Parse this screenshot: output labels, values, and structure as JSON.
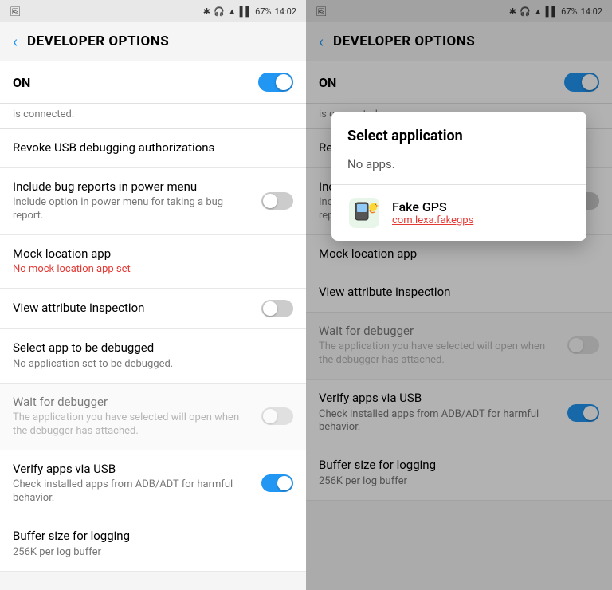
{
  "left_panel": {
    "status": {
      "left_icon": "📷",
      "bluetooth": "🔵",
      "wifi": "📶",
      "signal": "📶",
      "battery": "67%",
      "time": "14:02"
    },
    "header": {
      "back_label": "‹",
      "title": "DEVELOPER OPTIONS"
    },
    "on_label": "ON",
    "connected_text": "is connected.",
    "toggle_on": true,
    "items": [
      {
        "id": "revoke-usb",
        "title": "Revoke USB debugging authorizations",
        "subtitle": null,
        "toggle": null,
        "enabled": true
      },
      {
        "id": "bug-report",
        "title": "Include bug reports in power menu",
        "subtitle": "Include option in power menu for taking a bug report.",
        "toggle": "off",
        "enabled": true
      },
      {
        "id": "mock-location",
        "title": "Mock location app",
        "subtitle": "No mock location app set",
        "subtitle_red": true,
        "toggle": null,
        "enabled": true
      },
      {
        "id": "view-attr",
        "title": "View attribute inspection",
        "subtitle": null,
        "toggle": "off",
        "enabled": true
      },
      {
        "id": "select-debug",
        "title": "Select app to be debugged",
        "subtitle": "No application set to be debugged.",
        "toggle": null,
        "enabled": true
      },
      {
        "id": "wait-debugger",
        "title": "Wait for debugger",
        "subtitle": "The application you have selected will open when the debugger has attached.",
        "toggle": "off",
        "enabled": false
      },
      {
        "id": "verify-usb",
        "title": "Verify apps via USB",
        "subtitle": "Check installed apps from ADB/ADT for harmful behavior.",
        "toggle": "on",
        "enabled": true
      },
      {
        "id": "buffer-logging",
        "title": "Buffer size for logging",
        "subtitle": "256K per log buffer",
        "toggle": null,
        "enabled": true
      }
    ]
  },
  "right_panel": {
    "status": {
      "left_icon": "📷",
      "bluetooth": "🔵",
      "wifi": "📶",
      "signal": "📶",
      "battery": "67%",
      "time": "14:02"
    },
    "header": {
      "back_label": "‹",
      "title": "DEVELOPER OPTIONS"
    },
    "on_label": "ON",
    "connected_text": "is connected.",
    "toggle_on": true,
    "dialog": {
      "title": "Select application",
      "no_apps_label": "No apps.",
      "apps": [
        {
          "id": "fake-gps",
          "name": "Fake GPS",
          "package": "com.lexa.fakegps",
          "icon": "🐤"
        }
      ]
    },
    "items": [
      {
        "id": "revoke-usb",
        "title": "Revoke USB debugging authorizations",
        "subtitle": null,
        "toggle": null,
        "enabled": true
      },
      {
        "id": "bug-report",
        "title": "Include bug reports in power menu",
        "subtitle": "Include option in power menu for taking a bug report.",
        "toggle": "off",
        "enabled": true
      },
      {
        "id": "mock-location",
        "title": "Mock location app",
        "subtitle": null,
        "toggle": null,
        "enabled": true
      },
      {
        "id": "view-attr",
        "title": "View attribute inspection",
        "subtitle": null,
        "toggle": null,
        "enabled": true
      },
      {
        "id": "wait-debugger",
        "title": "Wait for debugger",
        "subtitle": "The application you have selected will open when the debugger has attached.",
        "toggle": "off",
        "enabled": false
      },
      {
        "id": "verify-usb",
        "title": "Verify apps via USB",
        "subtitle": "Check installed apps from ADB/ADT for harmful behavior.",
        "toggle": "on",
        "enabled": true
      },
      {
        "id": "buffer-logging",
        "title": "Buffer size for logging",
        "subtitle": "256K per log buffer",
        "toggle": null,
        "enabled": true
      }
    ]
  }
}
